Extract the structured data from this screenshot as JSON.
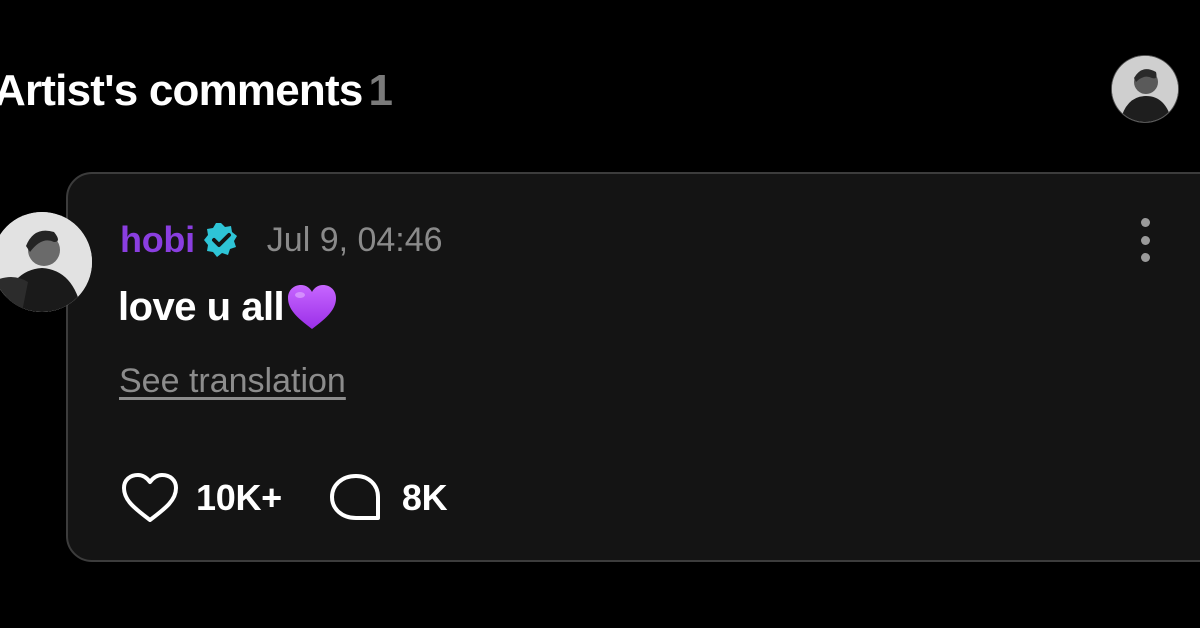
{
  "header": {
    "title": "Artist's comments",
    "count": "1"
  },
  "comment": {
    "author": "hobi",
    "timestamp": "Jul 9, 04:46",
    "text": "love u all",
    "translate_label": "See translation",
    "likes": "10K+",
    "replies": "8K"
  },
  "icons": {
    "verified": "verified-badge-icon",
    "heart_emoji": "purple-heart-emoji",
    "more": "more-vertical-icon",
    "like": "heart-outline-icon",
    "reply": "comment-bubble-icon"
  },
  "colors": {
    "background": "#000000",
    "card_background": "#141414",
    "card_border": "#3c3c3c",
    "author": "#8a3ee0",
    "verified_badge": "#2ec4d6",
    "heart_emoji": "#b04cf0",
    "muted_text": "#8a8a8a"
  }
}
